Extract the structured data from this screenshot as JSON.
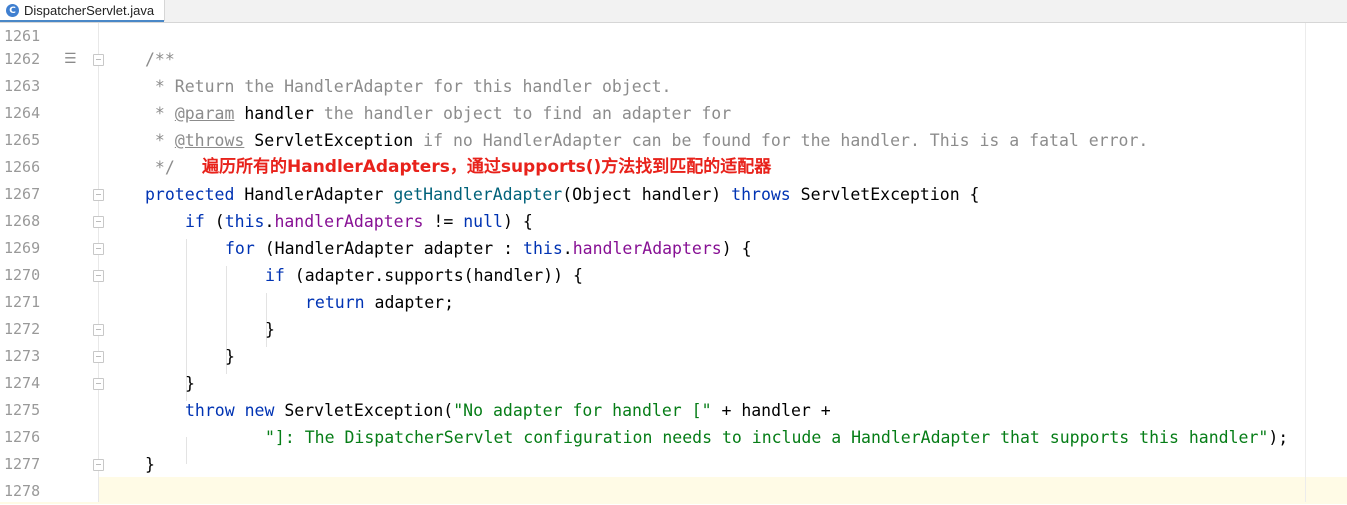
{
  "tab": {
    "file_name": "DispatcherServlet.java",
    "icon_letter": "C"
  },
  "annotation_text": "遍历所有的HandlerAdapters，通过supports()方法找到匹配的适配器",
  "lines": [
    {
      "n": "1261"
    },
    {
      "n": "1262"
    },
    {
      "n": "1263"
    },
    {
      "n": "1264"
    },
    {
      "n": "1265"
    },
    {
      "n": "1266"
    },
    {
      "n": "1267"
    },
    {
      "n": "1268"
    },
    {
      "n": "1269"
    },
    {
      "n": "1270"
    },
    {
      "n": "1271"
    },
    {
      "n": "1272"
    },
    {
      "n": "1273"
    },
    {
      "n": "1274"
    },
    {
      "n": "1275"
    },
    {
      "n": "1276"
    },
    {
      "n": "1277"
    },
    {
      "n": "1278"
    }
  ],
  "code": {
    "l1262": "/**",
    "l1263": " * Return the HandlerAdapter for this handler object.",
    "l1264_a": " * ",
    "l1264_tag": "@param",
    "l1264_b": " ",
    "l1264_c": "handler",
    "l1264_d": " the handler object to find an adapter for",
    "l1265_a": " * ",
    "l1265_tag": "@throws",
    "l1265_b": " ",
    "l1265_c": "ServletException",
    "l1265_d": " if no HandlerAdapter can be found for the handler. This is a fatal error.",
    "l1266": " */",
    "l1267_kw": "protected",
    "l1267_a": " HandlerAdapter ",
    "l1267_m": "getHandlerAdapter",
    "l1267_b": "(Object handler) ",
    "l1267_kw2": "throws",
    "l1267_c": " ServletException {",
    "l1268_kw": "if",
    "l1268_a": " (",
    "l1268_kw2": "this",
    "l1268_b": ".",
    "l1268_f": "handlerAdapters",
    "l1268_c": " != ",
    "l1268_kw3": "null",
    "l1268_d": ") {",
    "l1269_kw": "for",
    "l1269_a": " (HandlerAdapter adapter : ",
    "l1269_kw2": "this",
    "l1269_b": ".",
    "l1269_f": "handlerAdapters",
    "l1269_c": ") {",
    "l1270_kw": "if",
    "l1270_a": " (adapter.supports(handler)) {",
    "l1271_kw": "return",
    "l1271_a": " adapter;",
    "l1272": "}",
    "l1273": "}",
    "l1274": "}",
    "l1275_kw": "throw",
    "l1275_a": " ",
    "l1275_kw2": "new",
    "l1275_b": " ServletException(",
    "l1275_s": "\"No adapter for handler [\"",
    "l1275_c": " + handler +",
    "l1276_s": "\"]: The DispatcherServlet configuration needs to include a HandlerAdapter that supports this handler\"",
    "l1276_a": ");",
    "l1277": "}"
  }
}
